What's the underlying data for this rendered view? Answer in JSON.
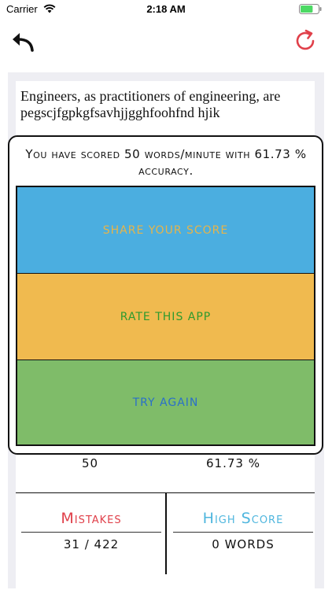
{
  "status_bar": {
    "carrier": "Carrier",
    "time": "2:18 AM",
    "battery_level": 0.7
  },
  "nav": {
    "back_icon": "back-arrow-icon",
    "refresh_icon": "refresh-icon",
    "accent_color": "#e0404a"
  },
  "passage": {
    "text": "Engineers, as practitioners of engineering, are pegscjfgpkgfsavhjjgghfoohfnd hjik"
  },
  "result": {
    "message": "You have scored 50 words/minute with 61.73 % accuracy.",
    "buttons": {
      "share": "Share your score",
      "rate": "Rate this app",
      "again": "Try again"
    },
    "colors": {
      "share_bg": "#4baee0",
      "rate_bg": "#f0ba4f",
      "again_bg": "#7fbc69"
    }
  },
  "stats": {
    "wpm_value": "50",
    "accuracy_value": "61.73 %",
    "mistakes_label": "Mistakes",
    "mistakes_value": "31 / 422",
    "high_score_label": "High Score",
    "high_score_value": "0 words"
  }
}
